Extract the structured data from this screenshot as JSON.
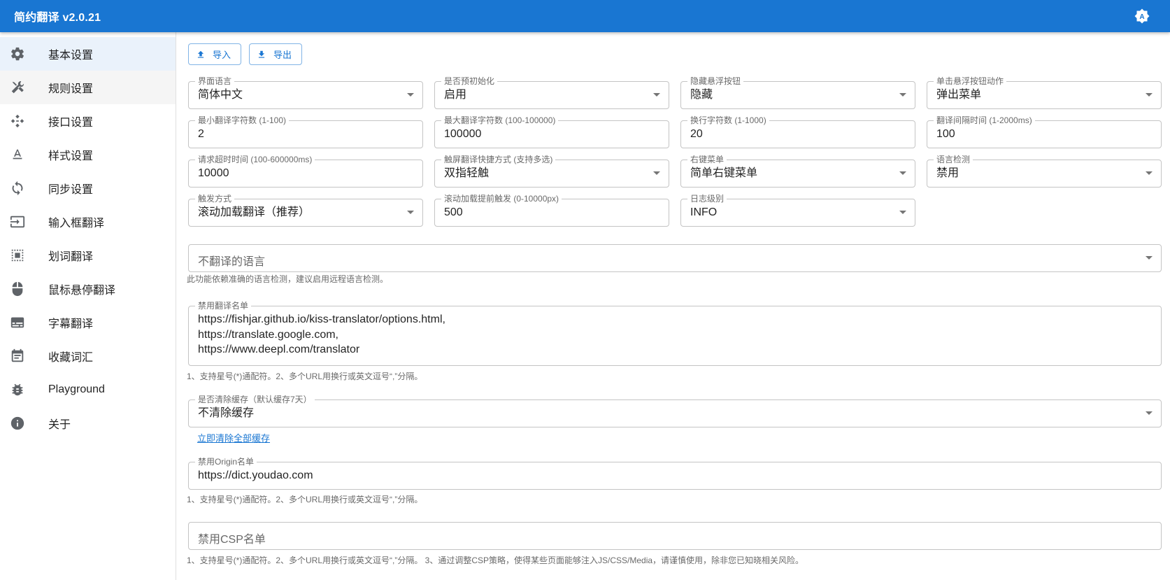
{
  "app": {
    "title": "简约翻译 v2.0.21"
  },
  "colors": {
    "primary": "#1976d2",
    "selected_bg": "#eaf2fb"
  },
  "sidebar": {
    "items": [
      {
        "label": "基本设置",
        "icon": "gear-icon"
      },
      {
        "label": "规则设置",
        "icon": "tools-icon"
      },
      {
        "label": "接口设置",
        "icon": "api-icon"
      },
      {
        "label": "样式设置",
        "icon": "text-format-icon"
      },
      {
        "label": "同步设置",
        "icon": "sync-icon"
      },
      {
        "label": "输入框翻译",
        "icon": "input-icon"
      },
      {
        "label": "划词翻译",
        "icon": "select-text-icon"
      },
      {
        "label": "鼠标悬停翻译",
        "icon": "mouse-icon"
      },
      {
        "label": "字幕翻译",
        "icon": "subtitles-icon"
      },
      {
        "label": "收藏词汇",
        "icon": "event-note-icon"
      },
      {
        "label": "Playground",
        "icon": "bug-icon"
      },
      {
        "label": "关于",
        "icon": "info-icon"
      }
    ]
  },
  "toolbar": {
    "import_label": "导入",
    "export_label": "导出"
  },
  "settings": {
    "ui_language": {
      "label": "界面语言",
      "value": "简体中文"
    },
    "pre_init": {
      "label": "是否预初始化",
      "value": "启用"
    },
    "hide_fab": {
      "label": "隐藏悬浮按钮",
      "value": "隐藏"
    },
    "fab_click": {
      "label": "单击悬浮按钮动作",
      "value": "弹出菜单"
    },
    "min_chars": {
      "label": "最小翻译字符数 (1-100)",
      "value": "2"
    },
    "max_chars": {
      "label": "最大翻译字符数 (100-100000)",
      "value": "100000"
    },
    "newline_chars": {
      "label": "换行字符数 (1-1000)",
      "value": "20"
    },
    "interval": {
      "label": "翻译间隔时间 (1-2000ms)",
      "value": "100"
    },
    "timeout": {
      "label": "请求超时时间 (100-600000ms)",
      "value": "10000"
    },
    "touch_shortcut": {
      "label": "触屏翻译快捷方式 (支持多选)",
      "value": "双指轻触"
    },
    "context_menu": {
      "label": "右键菜单",
      "value": "简单右键菜单"
    },
    "lang_detect": {
      "label": "语言检测",
      "value": "禁用"
    },
    "trigger": {
      "label": "触发方式",
      "value": "滚动加载翻译（推荐）"
    },
    "scroll_preload": {
      "label": "滚动加载提前触发 (0-10000px)",
      "value": "500"
    },
    "log_level": {
      "label": "日志级别",
      "value": "INFO"
    },
    "skip_langs": {
      "placeholder": "不翻译的语言",
      "helper": "此功能依赖准确的语言检测，建议启用远程语言检测。"
    },
    "blacklist": {
      "label": "禁用翻译名单",
      "lines": [
        "https://fishjar.github.io/kiss-translator/options.html,",
        "https://translate.google.com,",
        "https://www.deepl.com/translator"
      ],
      "helper": "1、支持星号(*)通配符。2、多个URL用换行或英文逗号“,”分隔。"
    },
    "cache": {
      "label": "是否清除缓存（默认缓存7天）",
      "value": "不清除缓存",
      "link": "立即清除全部缓存"
    },
    "origin_blacklist": {
      "label": "禁用Origin名单",
      "value": "https://dict.youdao.com",
      "helper": "1、支持星号(*)通配符。2、多个URL用换行或英文逗号“,”分隔。"
    },
    "csp_blacklist": {
      "placeholder": "禁用CSP名单",
      "helper": "1、支持星号(*)通配符。2、多个URL用换行或英文逗号“,”分隔。 3、通过调整CSP策略，使得某些页面能够注入JS/CSS/Media，请谨慎使用，除非您已知晓相关风险。"
    }
  }
}
